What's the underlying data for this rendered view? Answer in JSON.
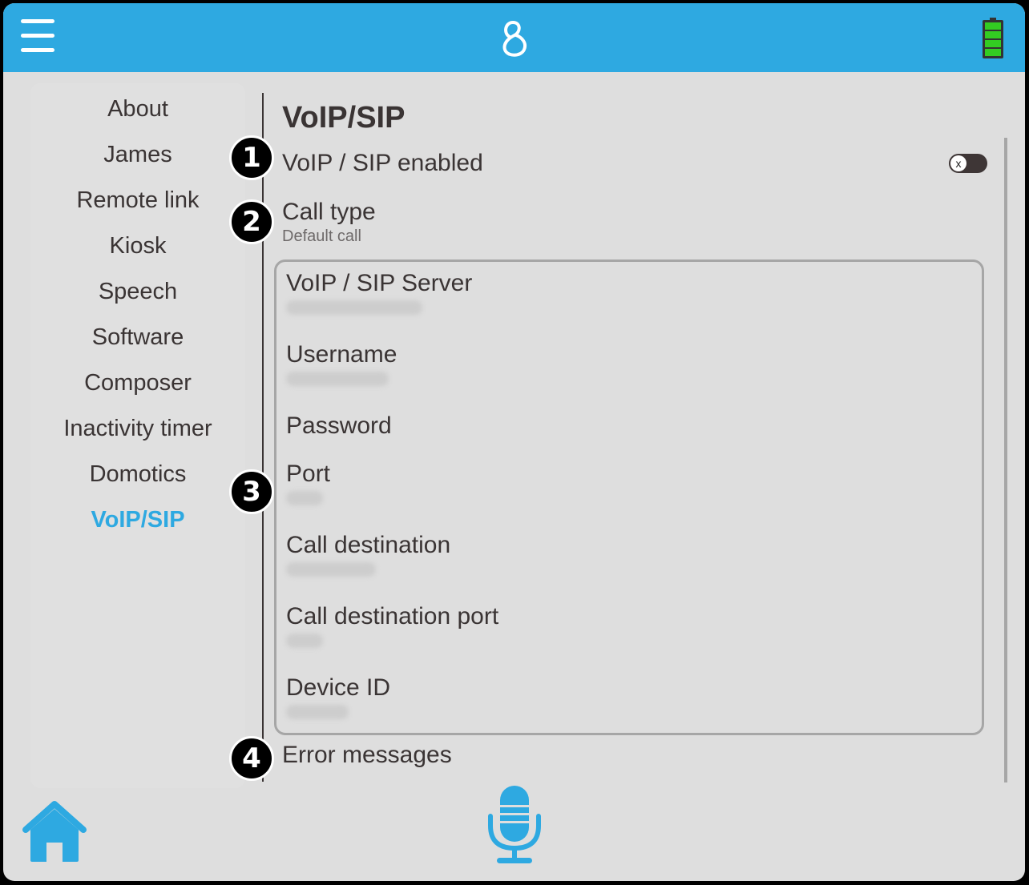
{
  "topbar": {
    "menu_icon": "hamburger-menu-icon",
    "logo_icon": "app-logo-icon",
    "battery_icon": "battery-full-icon",
    "battery_level": 1.0,
    "colors": {
      "bar": "#2ea9e1",
      "battery": "#33cc22"
    }
  },
  "sidebar": {
    "items": [
      {
        "label": "About",
        "active": false
      },
      {
        "label": "James",
        "active": false
      },
      {
        "label": "Remote link",
        "active": false
      },
      {
        "label": "Kiosk",
        "active": false
      },
      {
        "label": "Speech",
        "active": false
      },
      {
        "label": "Software",
        "active": false
      },
      {
        "label": "Composer",
        "active": false
      },
      {
        "label": "Inactivity timer",
        "active": false
      },
      {
        "label": "Domotics",
        "active": false
      },
      {
        "label": "VoIP/SIP",
        "active": true
      }
    ],
    "active_color": "#2ea9e1"
  },
  "main": {
    "title": "VoIP/SIP",
    "enabled": {
      "label": "VoIP / SIP enabled",
      "value": false,
      "toggle_glyph": "x"
    },
    "call_type": {
      "label": "Call type",
      "value": "Default call"
    },
    "fields": [
      {
        "label": "VoIP / SIP Server",
        "value": "[blurred]"
      },
      {
        "label": "Username",
        "value": "[blurred]"
      },
      {
        "label": "Password",
        "value": ""
      },
      {
        "label": "Port",
        "value": "[blurred]"
      },
      {
        "label": "Call destination",
        "value": "[blurred]"
      },
      {
        "label": "Call destination port",
        "value": "[blurred]"
      },
      {
        "label": "Device ID",
        "value": "[blurred]"
      }
    ],
    "error_messages": {
      "label": "Error messages"
    }
  },
  "callouts": [
    "1",
    "2",
    "3",
    "4"
  ],
  "bottombar": {
    "home_icon": "home-icon",
    "mic_icon": "microphone-icon",
    "color": "#2ea9e1"
  }
}
